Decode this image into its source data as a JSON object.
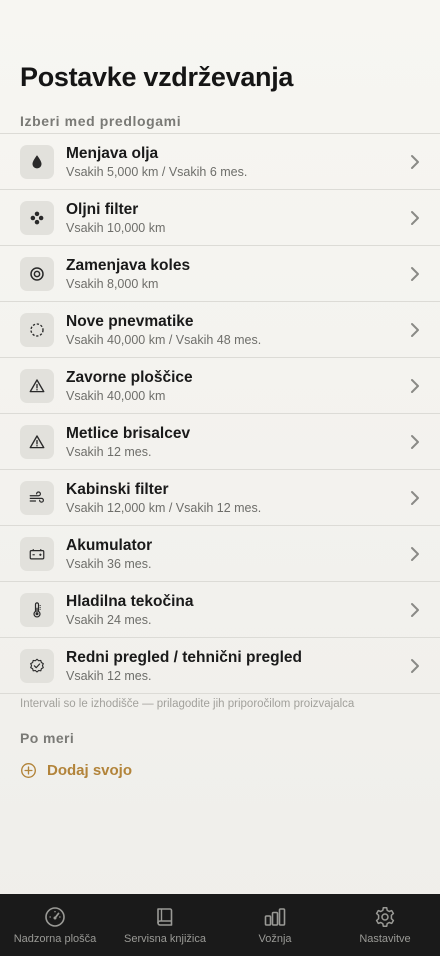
{
  "header": {
    "title": "Postavke vzdrževanja"
  },
  "suggestions": {
    "heading": "Izberi med predlogami",
    "items": [
      {
        "title": "Menjava olja",
        "subtitle": "Vsakih 5,000 km / Vsakih 6 mes.",
        "icon": "oil-drop-icon"
      },
      {
        "title": "Oljni filter",
        "subtitle": "Vsakih 10,000 km",
        "icon": "filter-dots-icon"
      },
      {
        "title": "Zamenjava koles",
        "subtitle": "Vsakih 8,000 km",
        "icon": "wheel-icon"
      },
      {
        "title": "Nove pnevmatike",
        "subtitle": "Vsakih 40,000 km / Vsakih 48 mes.",
        "icon": "tire-dashed-icon"
      },
      {
        "title": "Zavorne ploščice",
        "subtitle": "Vsakih 40,000 km",
        "icon": "warning-triangle-icon"
      },
      {
        "title": "Metlice brisalcev",
        "subtitle": "Vsakih 12 mes.",
        "icon": "warning-triangle-icon"
      },
      {
        "title": "Kabinski filter",
        "subtitle": "Vsakih 12,000 km / Vsakih 12 mes.",
        "icon": "wind-icon"
      },
      {
        "title": "Akumulator",
        "subtitle": "Vsakih 36 mes.",
        "icon": "battery-icon"
      },
      {
        "title": "Hladilna tekočina",
        "subtitle": "Vsakih 24 mes.",
        "icon": "thermometer-icon"
      },
      {
        "title": "Redni pregled / tehnični pregled",
        "subtitle": "Vsakih 12 mes.",
        "icon": "checkmark-seal-icon"
      }
    ],
    "footnote": "Intervali so le izhodišče — prilagodite jih priporočilom proizvajalca"
  },
  "custom": {
    "heading": "Po meri",
    "add_label": "Dodaj svojo"
  },
  "colors": {
    "accent": "#b2843a",
    "tabbar": "#1a1a1a"
  },
  "tabbar": {
    "tabs": [
      {
        "label": "Nadzorna plošča",
        "icon": "gauge-icon"
      },
      {
        "label": "Servisna knjižica",
        "icon": "book-icon"
      },
      {
        "label": "Vožnja",
        "icon": "bars-icon"
      },
      {
        "label": "Nastavitve",
        "icon": "gear-icon"
      }
    ]
  }
}
